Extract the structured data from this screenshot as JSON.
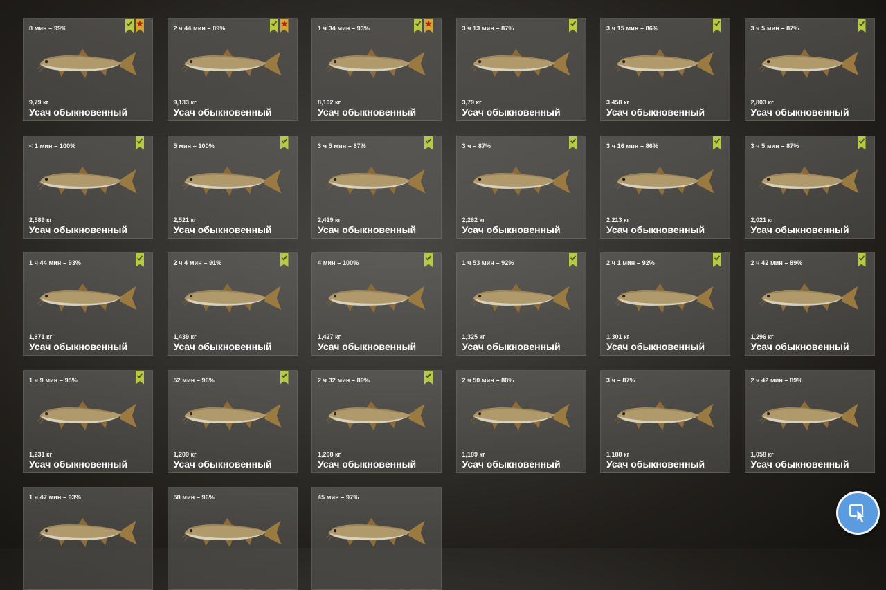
{
  "catches": [
    {
      "time": "8 мин – 99%",
      "weight": "9,79 кг",
      "name": "Усач обыкновенный",
      "badges": [
        "check",
        "star"
      ]
    },
    {
      "time": "2 ч 44 мин – 89%",
      "weight": "9,133 кг",
      "name": "Усач обыкновенный",
      "badges": [
        "check",
        "star"
      ]
    },
    {
      "time": "1 ч 34 мин – 93%",
      "weight": "8,102 кг",
      "name": "Усач обыкновенный",
      "badges": [
        "check",
        "star"
      ]
    },
    {
      "time": "3 ч 13 мин – 87%",
      "weight": "3,79 кг",
      "name": "Усач обыкновенный",
      "badges": [
        "check"
      ]
    },
    {
      "time": "3 ч 15 мин – 86%",
      "weight": "3,458 кг",
      "name": "Усач обыкновенный",
      "badges": [
        "check"
      ]
    },
    {
      "time": "3 ч 5 мин – 87%",
      "weight": "2,803 кг",
      "name": "Усач обыкновенный",
      "badges": [
        "check"
      ]
    },
    {
      "time": "< 1 мин – 100%",
      "weight": "2,589 кг",
      "name": "Усач обыкновенный",
      "badges": [
        "check"
      ]
    },
    {
      "time": "5 мин – 100%",
      "weight": "2,521 кг",
      "name": "Усач обыкновенный",
      "badges": [
        "check"
      ]
    },
    {
      "time": "3 ч 5 мин – 87%",
      "weight": "2,419 кг",
      "name": "Усач обыкновенный",
      "badges": [
        "check"
      ]
    },
    {
      "time": "3 ч – 87%",
      "weight": "2,262 кг",
      "name": "Усач обыкновенный",
      "badges": [
        "check"
      ]
    },
    {
      "time": "3 ч 16 мин – 86%",
      "weight": "2,213 кг",
      "name": "Усач обыкновенный",
      "badges": [
        "check"
      ]
    },
    {
      "time": "3 ч 5 мин – 87%",
      "weight": "2,021 кг",
      "name": "Усач обыкновенный",
      "badges": [
        "check"
      ]
    },
    {
      "time": "1 ч 44 мин – 93%",
      "weight": "1,871 кг",
      "name": "Усач обыкновенный",
      "badges": [
        "check"
      ]
    },
    {
      "time": "2 ч 4 мин – 91%",
      "weight": "1,439 кг",
      "name": "Усач обыкновенный",
      "badges": [
        "check"
      ]
    },
    {
      "time": "4 мин – 100%",
      "weight": "1,427 кг",
      "name": "Усач обыкновенный",
      "badges": [
        "check"
      ]
    },
    {
      "time": "1 ч 53 мин – 92%",
      "weight": "1,325 кг",
      "name": "Усач обыкновенный",
      "badges": [
        "check"
      ]
    },
    {
      "time": "2 ч 1 мин – 92%",
      "weight": "1,301 кг",
      "name": "Усач обыкновенный",
      "badges": [
        "check"
      ]
    },
    {
      "time": "2 ч 42 мин – 89%",
      "weight": "1,296 кг",
      "name": "Усач обыкновенный",
      "badges": [
        "check"
      ]
    },
    {
      "time": "1 ч 9 мин – 95%",
      "weight": "1,231 кг",
      "name": "Усач обыкновенный",
      "badges": [
        "check"
      ]
    },
    {
      "time": "52 мин – 96%",
      "weight": "1,209 кг",
      "name": "Усач обыкновенный",
      "badges": [
        "check"
      ]
    },
    {
      "time": "2 ч 32 мин – 89%",
      "weight": "1,208 кг",
      "name": "Усач обыкновенный",
      "badges": [
        "check"
      ]
    },
    {
      "time": "2 ч 50 мин – 88%",
      "weight": "1,189 кг",
      "name": "Усач обыкновенный",
      "badges": []
    },
    {
      "time": "3 ч – 87%",
      "weight": "1,188 кг",
      "name": "Усач обыкновенный",
      "badges": []
    },
    {
      "time": "2 ч 42 мин – 89%",
      "weight": "1,058 кг",
      "name": "Усач обыкновенный",
      "badges": []
    },
    {
      "time": "1 ч 47 мин – 93%",
      "weight": "",
      "name": "",
      "badges": []
    },
    {
      "time": "58 мин – 96%",
      "weight": "",
      "name": "",
      "badges": []
    },
    {
      "time": "45 мин – 97%",
      "weight": "",
      "name": "",
      "badges": []
    }
  ],
  "icons": {
    "fish": "barbel-fish-icon",
    "check": "check-badge-icon",
    "star": "star-badge-icon",
    "cursor": "cursor-pointer-icon"
  },
  "colors": {
    "check_badge": "#b9c943",
    "star_badge": "#d5a52c",
    "floating_button": "#5b9be0"
  }
}
